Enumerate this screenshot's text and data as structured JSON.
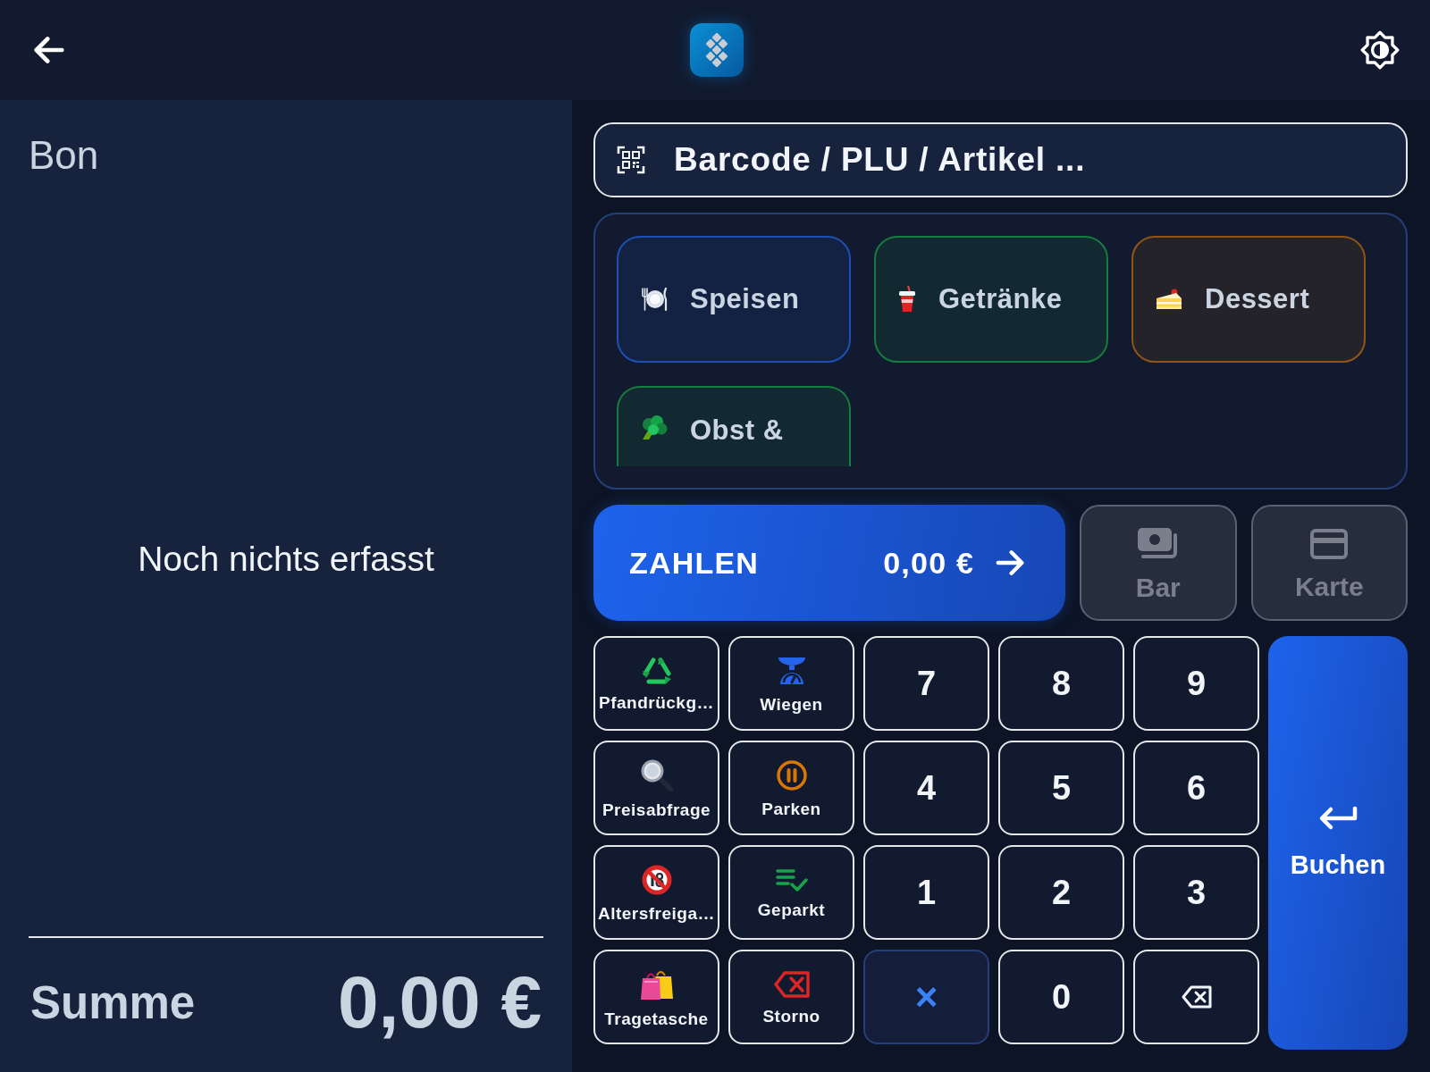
{
  "receipt": {
    "title": "Bon",
    "empty_message": "Noch nichts erfasst",
    "total_label": "Summe",
    "total_value": "0,00 €"
  },
  "search": {
    "placeholder": "Barcode / PLU / Artikel ..."
  },
  "categories": [
    {
      "label": "Speisen",
      "kind": "food",
      "color": "#1e4fb3"
    },
    {
      "label": "Getränke",
      "kind": "drink",
      "color": "#177a3f"
    },
    {
      "label": "Dessert",
      "kind": "dessert",
      "color": "#8f5517"
    },
    {
      "label": "Obst &",
      "kind": "produce",
      "color": "#177a3f"
    }
  ],
  "payment": {
    "pay_button": {
      "label": "ZAHLEN",
      "amount": "0,00 €"
    },
    "methods": [
      {
        "label": "Bar",
        "kind": "cash",
        "disabled": true
      },
      {
        "label": "Karte",
        "kind": "card",
        "disabled": true
      }
    ]
  },
  "keypad": {
    "function_keys": [
      {
        "label": "Pfandrückg…",
        "kind": "deposit"
      },
      {
        "label": "Wiegen",
        "kind": "weigh"
      },
      {
        "label": "Preisabfrage",
        "kind": "pricecheck"
      },
      {
        "label": "Parken",
        "kind": "park"
      },
      {
        "label": "Altersfreiga…",
        "kind": "agecheck"
      },
      {
        "label": "Geparkt",
        "kind": "parked"
      },
      {
        "label": "Tragetasche",
        "kind": "bag"
      },
      {
        "label": "Storno",
        "kind": "void"
      }
    ],
    "number_keys": [
      {
        "label": "7",
        "kind": "digit"
      },
      {
        "label": "8",
        "kind": "digit"
      },
      {
        "label": "9",
        "kind": "digit"
      },
      {
        "label": "4",
        "kind": "digit"
      },
      {
        "label": "5",
        "kind": "digit"
      },
      {
        "label": "6",
        "kind": "digit"
      },
      {
        "label": "1",
        "kind": "digit"
      },
      {
        "label": "2",
        "kind": "digit"
      },
      {
        "label": "3",
        "kind": "digit"
      },
      {
        "label": "×",
        "kind": "operator"
      },
      {
        "label": "0",
        "kind": "digit"
      },
      {
        "kind": "backspace"
      }
    ],
    "enter_key": {
      "label": "Buchen"
    }
  }
}
